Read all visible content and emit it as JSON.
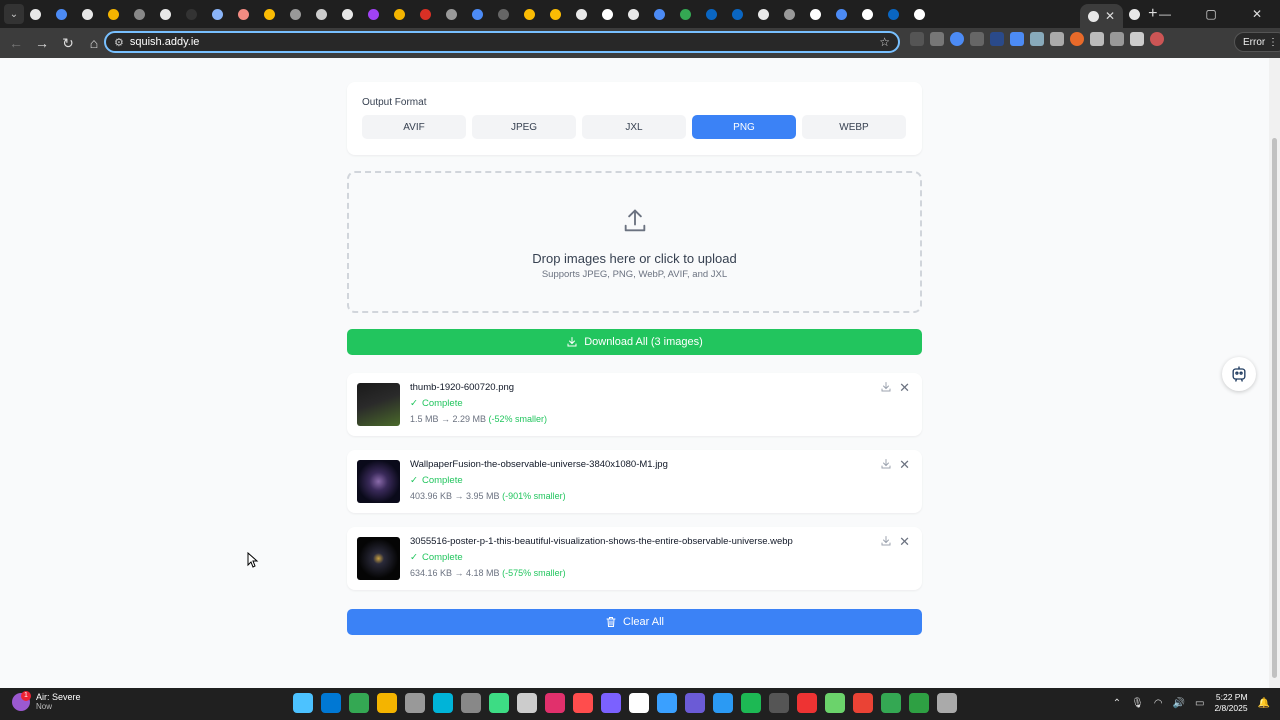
{
  "browser": {
    "tab_favicon_colors": [
      "#e8e8e8",
      "#4c8bf5",
      "#e8e8e8",
      "#f4b400",
      "#888",
      "#e8e8e8",
      "#333",
      "#8ab4f8",
      "#f28b82",
      "#fbbc04",
      "#999",
      "#ccc",
      "#e8e8e8",
      "#a142f4",
      "#f4b400",
      "#d93025",
      "#999",
      "#4c8bf5",
      "#666",
      "#fbbc04",
      "#fbbc04",
      "#e8e8e8",
      "#fff",
      "#e8e8e8",
      "#4c8bf5",
      "#34a853",
      "#0a66c2",
      "#0a66c2",
      "#e8e8e8",
      "#999",
      "#fff",
      "#4c8bf5",
      "#fff",
      "#0a66c2",
      "#fff"
    ],
    "active_tab_close": "✕",
    "new_tab": "+",
    "window_controls": {
      "minimize": "—",
      "maximize": "▢",
      "close": "✕"
    },
    "url": "squish.addy.ie",
    "error_button": "Error"
  },
  "page": {
    "output_format": {
      "label": "Output Format",
      "options": [
        "AVIF",
        "JPEG",
        "JXL",
        "PNG",
        "WEBP"
      ],
      "selected": "PNG"
    },
    "dropzone": {
      "title": "Drop images here or click to upload",
      "subtitle": "Supports JPEG, PNG, WebP, AVIF, and JXL"
    },
    "download_all_label": "Download All (3 images)",
    "files": [
      {
        "name": "thumb-1920-600720.png",
        "status": "Complete",
        "sizes": "1.5 MB → 2.29 MB",
        "change": "(-52% smaller)",
        "thumb_colors": [
          "#1a1a1a",
          "#4a6a2a",
          "#e8e8e8"
        ]
      },
      {
        "name": "WallpaperFusion-the-observable-universe-3840x1080-M1.jpg",
        "status": "Complete",
        "sizes": "403.96 KB → 3.95 MB",
        "change": "(-901% smaller)",
        "thumb_colors": [
          "#0a0a1a",
          "#3a2a5a",
          "#8a6aaa"
        ]
      },
      {
        "name": "3055516-poster-p-1-this-beautiful-visualization-shows-the-entire-observable-universe.webp",
        "status": "Complete",
        "sizes": "634.16 KB → 4.18 MB",
        "change": "(-575% smaller)",
        "thumb_colors": [
          "#050505",
          "#2a2a3a",
          "#c8a040"
        ]
      }
    ],
    "clear_all_label": "Clear All"
  },
  "taskbar": {
    "weather_title": "Air: Severe",
    "weather_sub": "Now",
    "weather_badge": "1",
    "app_colors": [
      "#4cc2ff",
      "#0078d4",
      "#34a853",
      "#f4b400",
      "#999",
      "#00b4d8",
      "#888",
      "#3ddc84",
      "#ccc",
      "#e1306c",
      "#ff4d4d",
      "#7b61ff",
      "#fff",
      "#3aa0ff",
      "#6b5bd6",
      "#2b9af3",
      "#1db954",
      "#555",
      "#e33",
      "#6bd36b",
      "#ea4335",
      "#34a853",
      "#2ea043",
      "#aaa"
    ],
    "time": "5:22 PM",
    "date": "2/8/2025"
  }
}
